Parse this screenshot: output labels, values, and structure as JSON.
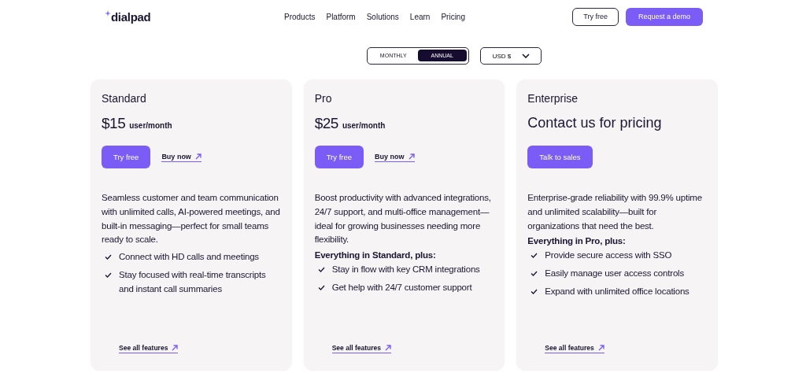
{
  "header": {
    "logo": "dialpad",
    "nav": [
      "Products",
      "Platform",
      "Solutions",
      "Learn",
      "Pricing"
    ],
    "buttons": [
      {
        "label": "Try free",
        "kind": "outline"
      },
      {
        "label": "Request a demo",
        "kind": "primary"
      }
    ]
  },
  "billing": {
    "options": [
      {
        "label": "MONTHLY",
        "selected": false
      },
      {
        "label": "ANNUAL",
        "selected": true
      }
    ],
    "currency": "USD $"
  },
  "plans": [
    {
      "name": "Standard",
      "price": "$15",
      "unit": "user/month",
      "actions": [
        {
          "label": "Try free",
          "kind": "primary"
        },
        {
          "label": "Buy now",
          "kind": "link"
        }
      ],
      "description": "Seamless customer and team communication with unlimited calls, AI-powered meetings, and built-in messaging—perfect for small teams ready to scale.",
      "features": [
        "Connect with HD calls and meetings",
        "Stay focused with real-time transcripts and instant call summaries"
      ],
      "link": "See all features"
    },
    {
      "name": "Pro",
      "price": "$25",
      "unit": "user/month",
      "actions": [
        {
          "label": "Try free",
          "kind": "primary"
        },
        {
          "label": "Buy now",
          "kind": "link"
        }
      ],
      "description": "Boost productivity with advanced integrations, 24/7 support, and multi-office management—ideal for growing businesses needing more flexibility.",
      "features_heading": "Everything in Standard, plus:",
      "features": [
        "Stay in flow with key CRM integrations",
        "Get help with 24/7 customer support"
      ],
      "link": "See all features"
    },
    {
      "name": "Enterprise",
      "price": "Contact us for pricing",
      "actions": [
        {
          "label": "Talk to sales",
          "kind": "primary"
        }
      ],
      "description": "Enterprise-grade reliability with 99.9% uptime and unlimited scalability—built for organizations that need the best.",
      "features_heading": "Everything in Pro, plus:",
      "features": [
        "Provide secure access with SSO",
        "Easily manage user access controls",
        "Expand with unlimited office locations"
      ],
      "link": "See all features"
    }
  ]
}
